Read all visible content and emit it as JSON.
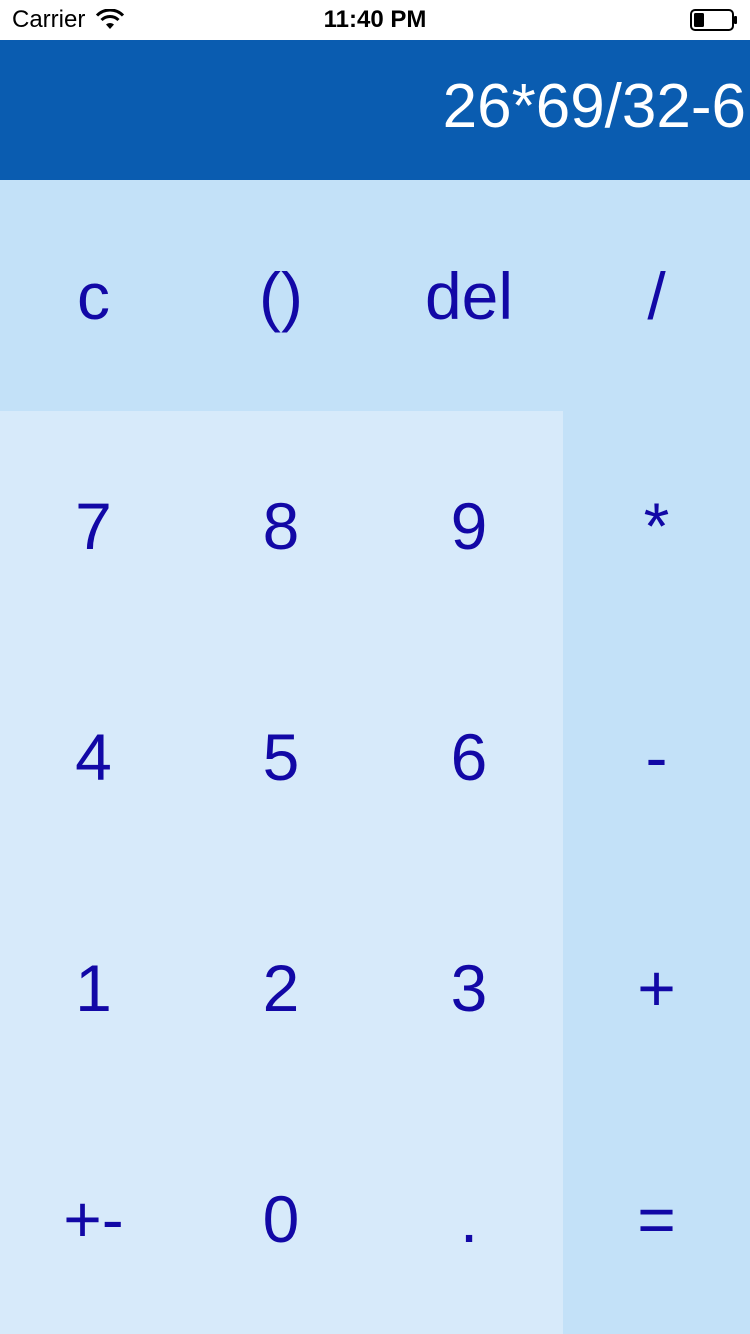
{
  "status_bar": {
    "carrier": "Carrier",
    "time": "11:40 PM",
    "wifi_icon": "wifi-icon",
    "battery_icon": "battery-low-icon"
  },
  "display": {
    "expression": "26*69/32-6"
  },
  "colors": {
    "display_bg": "#0a5cb0",
    "function_key_bg": "#c3e1f8",
    "number_key_bg": "#d7eafa",
    "key_text": "#1208a6"
  },
  "keys": {
    "clear": "c",
    "parens": "()",
    "delete": "del",
    "divide": "/",
    "seven": "7",
    "eight": "8",
    "nine": "9",
    "multiply": "*",
    "four": "4",
    "five": "5",
    "six": "6",
    "minus": "-",
    "one": "1",
    "two": "2",
    "three": "3",
    "plus": "+",
    "sign": "+-",
    "zero": "0",
    "decimal": ".",
    "equals": "="
  }
}
